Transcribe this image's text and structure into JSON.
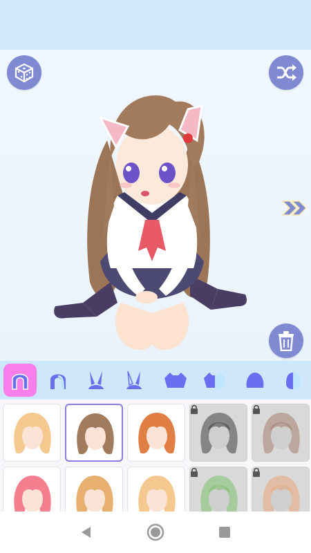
{
  "app": {
    "colors": {
      "accent": "#7f8ad2",
      "tab_active": "#f87fea",
      "tab_icon": "#6a6ff0",
      "tab_bg": "#cfe7fa"
    }
  },
  "toolbar": {
    "random_icon": "dice-icon",
    "shuffle_icon": "shuffle-icon",
    "delete_icon": "trash-icon",
    "next_icon": "double-chevron-right-icon"
  },
  "tabs": [
    {
      "id": "hair-back",
      "icon": "hair-back-icon",
      "active": true
    },
    {
      "id": "hair-front",
      "icon": "hair-front-icon",
      "active": false
    },
    {
      "id": "ears",
      "icon": "bunny-ears-icon",
      "active": false
    },
    {
      "id": "ears-alt",
      "icon": "bunny-ears-outline-icon",
      "active": false
    },
    {
      "id": "top",
      "icon": "shirt-icon",
      "active": false
    },
    {
      "id": "top-alt",
      "icon": "shirt-split-icon",
      "active": false
    },
    {
      "id": "hat",
      "icon": "blob-hat-icon",
      "active": false
    },
    {
      "id": "hat-alt",
      "icon": "half-head-icon",
      "active": false
    }
  ],
  "hair_options": [
    {
      "color": "#f5c890",
      "locked": false,
      "selected": false
    },
    {
      "color": "#a27a5c",
      "locked": false,
      "selected": true
    },
    {
      "color": "#e07e43",
      "locked": false,
      "selected": false
    },
    {
      "color": "#3f3f3f",
      "locked": true,
      "selected": false
    },
    {
      "color": "#a27e6b",
      "locked": true,
      "selected": false
    },
    {
      "color": "#f47f8e",
      "locked": false,
      "selected": false
    },
    {
      "color": "#e8b070",
      "locked": false,
      "selected": false
    },
    {
      "color": "#f5c890",
      "locked": false,
      "selected": false
    },
    {
      "color": "#7cc06a",
      "locked": true,
      "selected": false
    },
    {
      "color": "#e9a57a",
      "locked": true,
      "selected": false
    }
  ],
  "nav": {
    "back_icon": "back-triangle-icon",
    "home_icon": "home-circle-icon",
    "recents_icon": "recents-square-icon"
  }
}
